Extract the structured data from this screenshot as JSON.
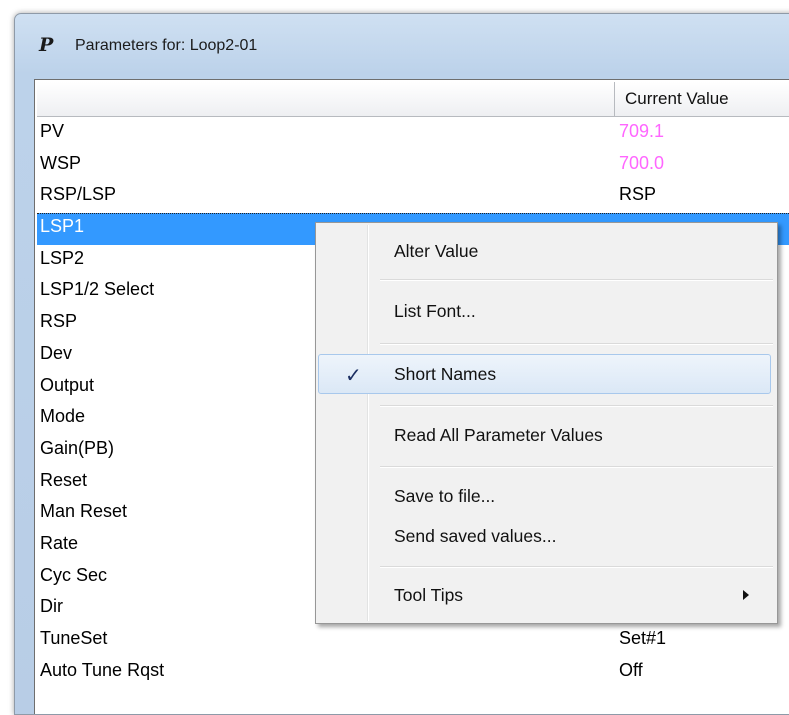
{
  "window": {
    "icon_glyph": "P",
    "title": "Parameters for: Loop2-01"
  },
  "table": {
    "columns": [
      "",
      "Current Value"
    ],
    "rows": [
      {
        "name": "PV",
        "value": "709.1",
        "value_color": "magenta"
      },
      {
        "name": "WSP",
        "value": "700.0",
        "value_color": "magenta"
      },
      {
        "name": "RSP/LSP",
        "value": "RSP"
      },
      {
        "name": "LSP1",
        "value": "",
        "selected": true
      },
      {
        "name": "LSP2",
        "value": ""
      },
      {
        "name": "LSP1/2 Select",
        "value": ""
      },
      {
        "name": "RSP",
        "value": ""
      },
      {
        "name": "Dev",
        "value": ""
      },
      {
        "name": "Output",
        "value": ""
      },
      {
        "name": "Mode",
        "value": ""
      },
      {
        "name": "Gain(PB)",
        "value": ""
      },
      {
        "name": "Reset",
        "value": ""
      },
      {
        "name": "Man Reset",
        "value": ""
      },
      {
        "name": "Rate",
        "value": ""
      },
      {
        "name": "Cyc Sec",
        "value": ""
      },
      {
        "name": "Dir",
        "value": ""
      },
      {
        "name": "TuneSet",
        "value": "Set#1"
      },
      {
        "name": "Auto Tune Rqst",
        "value": "Off"
      }
    ]
  },
  "context_menu": {
    "items": [
      {
        "label": "Alter Value"
      },
      {
        "label": "List Font..."
      },
      {
        "label": "Short Names",
        "checked": true,
        "check_glyph": "✓"
      },
      {
        "label": "Read All Parameter Values"
      },
      {
        "label": "Save to file..."
      },
      {
        "label": "Send saved values..."
      },
      {
        "label": "Tool Tips",
        "submenu": true
      }
    ]
  },
  "colors": {
    "selection": "#3399ff",
    "magenta_value": "#ff66ff"
  }
}
